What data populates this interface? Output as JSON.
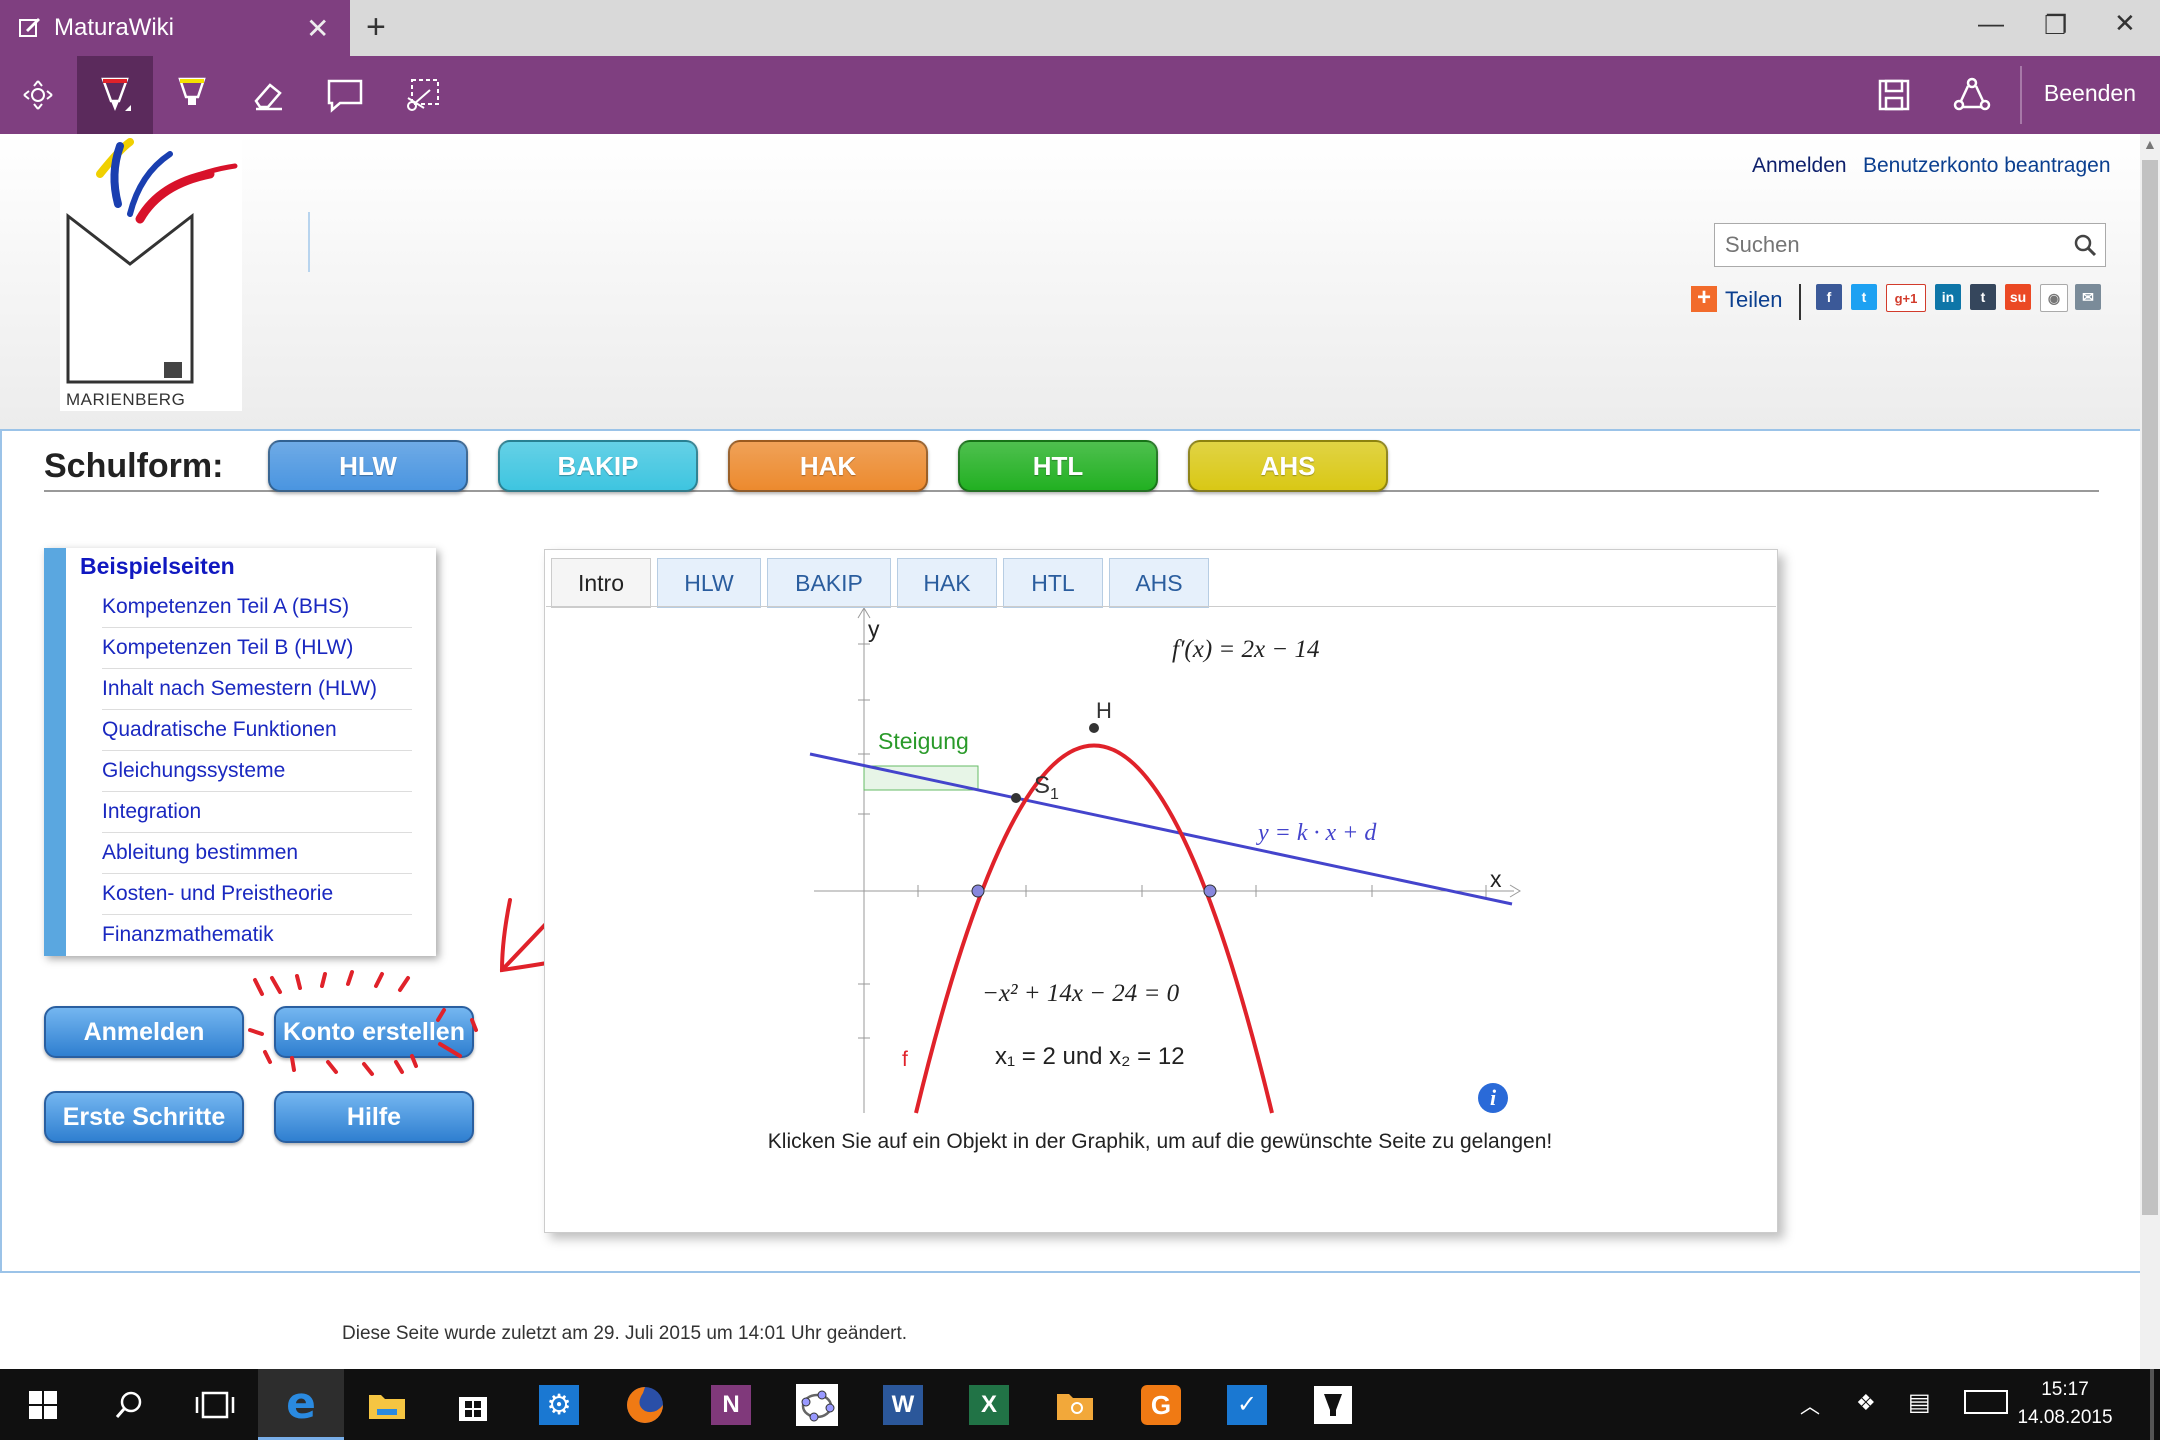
{
  "browser": {
    "tab_title": "MaturaWiki",
    "new_tab": "+",
    "finish_label": "Beenden"
  },
  "header": {
    "login_link": "Anmelden",
    "request_account_link": "Benutzerkonto beantragen",
    "search_placeholder": "Suchen",
    "share_label": "Teilen",
    "logo_text": "MARIENBERG"
  },
  "schulform": {
    "label": "Schulform:",
    "buttons": [
      {
        "label": "HLW",
        "color": "#4a95e0"
      },
      {
        "label": "BAKIP",
        "color": "#3ec5e0"
      },
      {
        "label": "HAK",
        "color": "#ec8a2e"
      },
      {
        "label": "HTL",
        "color": "#22b022"
      },
      {
        "label": "AHS",
        "color": "#d9c815"
      }
    ]
  },
  "sidebar": {
    "heading": "Beispielseiten",
    "items": [
      "Kompetenzen Teil A (BHS)",
      "Kompetenzen Teil B (HLW)",
      "Inhalt nach Semestern (HLW)",
      "Quadratische Funktionen",
      "Gleichungssysteme",
      "Integration",
      "Ableitung bestimmen",
      "Kosten- und Preistheorie",
      "Finanzmathematik"
    ],
    "buttons": {
      "login": "Anmelden",
      "create_account": "Konto erstellen",
      "first_steps": "Erste Schritte",
      "help": "Hilfe"
    }
  },
  "applet": {
    "tabs": [
      "Intro",
      "HLW",
      "BAKIP",
      "HAK",
      "HTL",
      "AHS"
    ],
    "active_tab": "Intro",
    "hint": "Klicken Sie auf ein Objekt in der Graphik, um auf die gewünschte Seite zu gelangen!",
    "graph": {
      "y_label": "y",
      "x_label": "x",
      "derivative": "f′(x) = 2x − 14",
      "point_h": "H",
      "point_s": "S",
      "point_s_sub": "1",
      "slope_label": "Steigung",
      "line_label": "y = k · x + d",
      "curve_label": "f",
      "equation": "−x² + 14x − 24 = 0",
      "roots": "x₁ = 2 und x₂ = 12",
      "info": "i"
    }
  },
  "footer": {
    "text": "Diese Seite wurde zuletzt am 29. Juli 2015 um 14:01 Uhr geändert."
  },
  "taskbar": {
    "time": "15:17",
    "date": "14.08.2015"
  },
  "colors": {
    "accent": "#7f3f80",
    "link": "#1a28c0",
    "annotation": "#e0222a"
  }
}
